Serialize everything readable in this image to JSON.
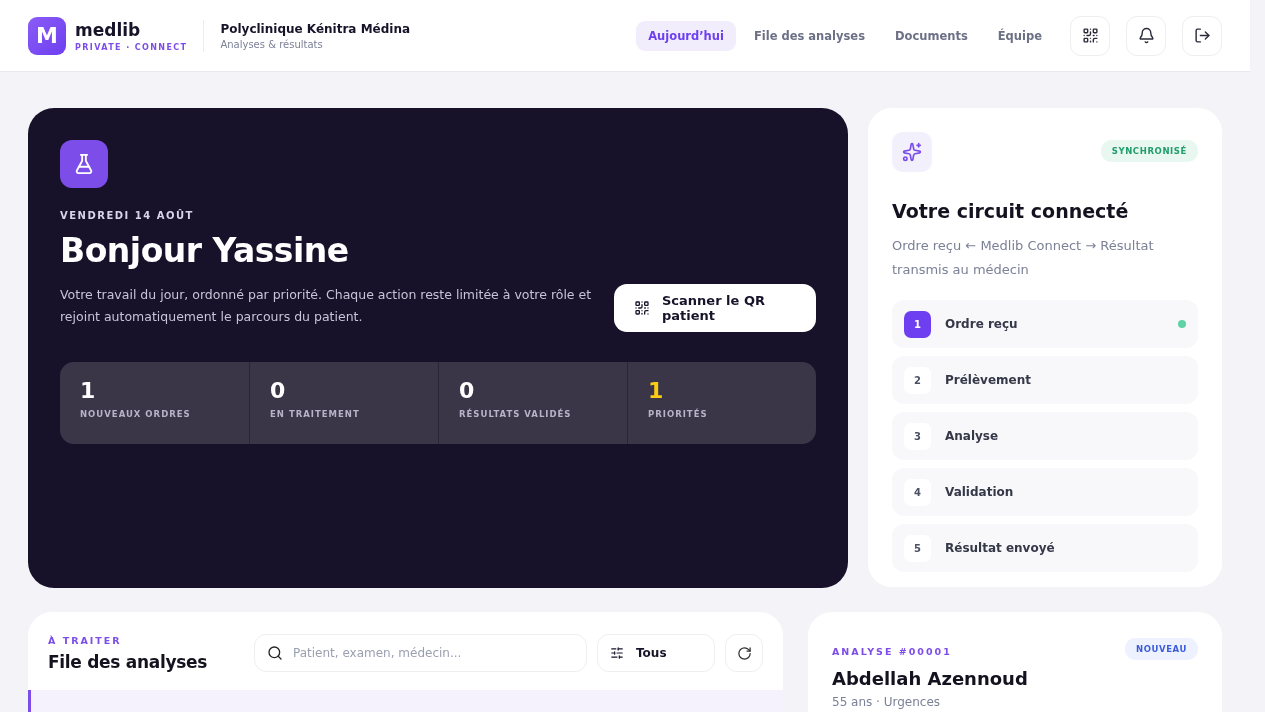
{
  "brand": {
    "logo_letter": "M",
    "name": "medlib",
    "tagline": "PRIVATE · CONNECT"
  },
  "clinic": {
    "name": "Polyclinique Kénitra Médina",
    "subtitle": "Analyses & résultats"
  },
  "nav": [
    {
      "label": "Aujourd’hui",
      "selected": true
    },
    {
      "label": "File des analyses",
      "selected": false
    },
    {
      "label": "Documents",
      "selected": false
    },
    {
      "label": "Équipe",
      "selected": false
    }
  ],
  "hero": {
    "date": "VENDREDI 14 AOÛT",
    "greeting": "Bonjour Yassine",
    "intro": "Votre travail du jour, ordonné par priorité. Chaque action reste limitée à votre rôle et rejoint automatiquement le parcours du patient.",
    "scan_button": "Scanner le QR patient",
    "stats": [
      {
        "value": "1",
        "label": "NOUVEAUX ORDRES",
        "color": "#ffffff"
      },
      {
        "value": "0",
        "label": "EN TRAITEMENT",
        "color": "#ffffff"
      },
      {
        "value": "0",
        "label": "RÉSULTATS VALIDÉS",
        "color": "#ffffff"
      },
      {
        "value": "1",
        "label": "PRIORITÉS",
        "color": "#facc15"
      }
    ]
  },
  "circuit": {
    "badge": "SYNCHRONISÉ",
    "title": "Votre circuit connecté",
    "description": "Ordre reçu ← Medlib Connect → Résultat transmis au médecin",
    "steps": [
      {
        "number": "1",
        "label": "Ordre reçu",
        "selected": true,
        "live": true
      },
      {
        "number": "2",
        "label": "Prélèvement",
        "selected": false,
        "live": false
      },
      {
        "number": "3",
        "label": "Analyse",
        "selected": false,
        "live": false
      },
      {
        "number": "4",
        "label": "Validation",
        "selected": false,
        "live": false
      },
      {
        "number": "5",
        "label": "Résultat envoyé",
        "selected": false,
        "live": false
      }
    ]
  },
  "queue": {
    "eyebrow": "À TRAITER",
    "title": "File des analyses",
    "search": {
      "placeholder": "Patient, examen, médecin..."
    },
    "filter": "Tous"
  },
  "analysis": {
    "eyebrow": "ANALYSE #00001",
    "badge": "NOUVEAU",
    "patient": "Abdellah Azennoud",
    "details": "55 ans · Urgences"
  }
}
